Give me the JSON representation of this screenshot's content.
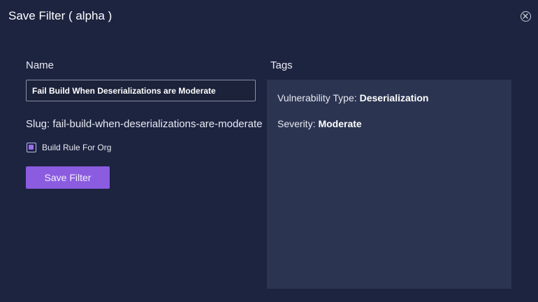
{
  "modal": {
    "title": "Save Filter ( alpha )",
    "close_icon": "close-circle-icon"
  },
  "form": {
    "name_label": "Name",
    "name_value": "Fail Build When Deserializations are Moderate",
    "slug_text": "Slug: fail-build-when-deserializations-are-moderate",
    "checkbox_label": "Build Rule For Org",
    "checkbox_checked": true,
    "save_label": "Save Filter"
  },
  "tags": {
    "label": "Tags",
    "items": [
      {
        "key": "Vulnerability Type:",
        "value": "Deserialization"
      },
      {
        "key": "Severity:",
        "value": "Moderate"
      }
    ]
  },
  "colors": {
    "background": "#1d2440",
    "panel": "#2b3451",
    "accent": "#8b5ce0"
  }
}
